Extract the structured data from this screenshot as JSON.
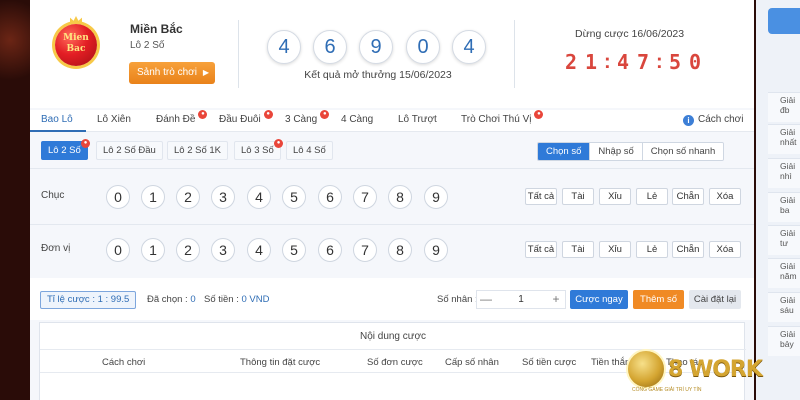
{
  "header": {
    "logo_text": "Mien Bac",
    "region": "Miền Bắc",
    "game": "Lô 2 Số",
    "lobby_button": "Sảnh trò chơi",
    "balls": [
      "4",
      "6",
      "9",
      "0",
      "4"
    ],
    "result_date": "Kết quả mở thưởng 15/06/2023",
    "stop_bet": "Dừng cược 16/06/2023",
    "countdown": [
      "2",
      "1",
      "4",
      "7",
      "5",
      "0"
    ]
  },
  "tabs": [
    {
      "label": "Bao Lô",
      "hot": false
    },
    {
      "label": "Lô Xiên",
      "hot": false
    },
    {
      "label": "Đánh Đề",
      "hot": true
    },
    {
      "label": "Đầu Đuôi",
      "hot": true
    },
    {
      "label": "3 Càng",
      "hot": true
    },
    {
      "label": "4 Càng",
      "hot": false
    },
    {
      "label": "Lô Trượt",
      "hot": false
    },
    {
      "label": "Trò Chơi Thú Vị",
      "hot": true
    }
  ],
  "help": {
    "icon": "i",
    "label": "Cách chơi"
  },
  "subtabs": [
    "Lô 2 Số",
    "Lô 2 Số Đầu",
    "Lô 2 Số 1K",
    "Lô 3 Số",
    "Lô 4 Số"
  ],
  "modes": [
    "Chọn số",
    "Nhập số",
    "Chọn số nhanh"
  ],
  "rows": [
    {
      "label": "Chục",
      "numbers": [
        "0",
        "1",
        "2",
        "3",
        "4",
        "5",
        "6",
        "7",
        "8",
        "9"
      ]
    },
    {
      "label": "Đơn vị",
      "numbers": [
        "0",
        "1",
        "2",
        "3",
        "4",
        "5",
        "6",
        "7",
        "8",
        "9"
      ]
    }
  ],
  "quick": [
    "Tất cả",
    "Tài",
    "Xỉu",
    "Lẻ",
    "Chẵn",
    "Xóa"
  ],
  "bet": {
    "ratio": "Tỉ lệ cược : 1 : 99.5",
    "selected_label": "Đã chọn : ",
    "selected_value": "0",
    "amount_label": "Số tiền : ",
    "amount_value": "0 VND",
    "multiplier_label": "Số nhân :",
    "multiplier_value": "1",
    "minus": "—",
    "plus": "+",
    "bet_now": "Cược ngay",
    "add_number": "Thêm số",
    "reset": "Cài đặt lại"
  },
  "table": {
    "title": "Nội dung cược",
    "columns": [
      "Cách chơi",
      "Thông tin đặt cược",
      "Số đơn cược",
      "Cấp số nhân",
      "Số tiền cược",
      "Tiền thắng",
      "Thao tác"
    ]
  },
  "right_rail": [
    "Giải đb",
    "Giải nhất",
    "Giải nhì",
    "Giải ba",
    "Giải tư",
    "Giải năm",
    "Giải sáu",
    "Giải bảy"
  ],
  "watermark": {
    "text": "8 WORK",
    "sub": "CỔNG GAME GIẢI TRÍ UY TÍN"
  },
  "colors": {
    "accent": "#2f7ad8",
    "orange": "#f08a24",
    "countdown": "#d9463d",
    "ball_digit": "#2f6db5"
  }
}
